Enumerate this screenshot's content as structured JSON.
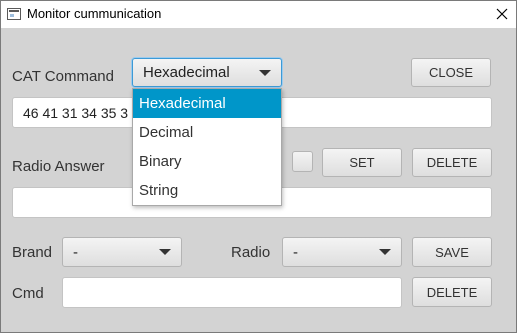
{
  "window": {
    "title": "Monitor cummunication"
  },
  "labels": {
    "cat_command": "CAT Command",
    "radio_answer": "Radio Answer",
    "brand": "Brand",
    "radio": "Radio",
    "cmd": "Cmd"
  },
  "buttons": {
    "close": "CLOSE",
    "set": "SET",
    "delete_answer": "DELETE",
    "save": "SAVE",
    "delete_cmd": "DELETE"
  },
  "format_select": {
    "selected": "Hexadecimal",
    "options": [
      "Hexadecimal",
      "Decimal",
      "Binary",
      "String"
    ]
  },
  "cat_command_field": {
    "value": "46 41 31 34 35 3"
  },
  "radio_answer_field": {
    "value": ""
  },
  "brand_select": {
    "selected": "-"
  },
  "radio_select": {
    "selected": "-"
  },
  "cmd_field": {
    "value": ""
  },
  "set_checkbox": {
    "checked": false
  }
}
